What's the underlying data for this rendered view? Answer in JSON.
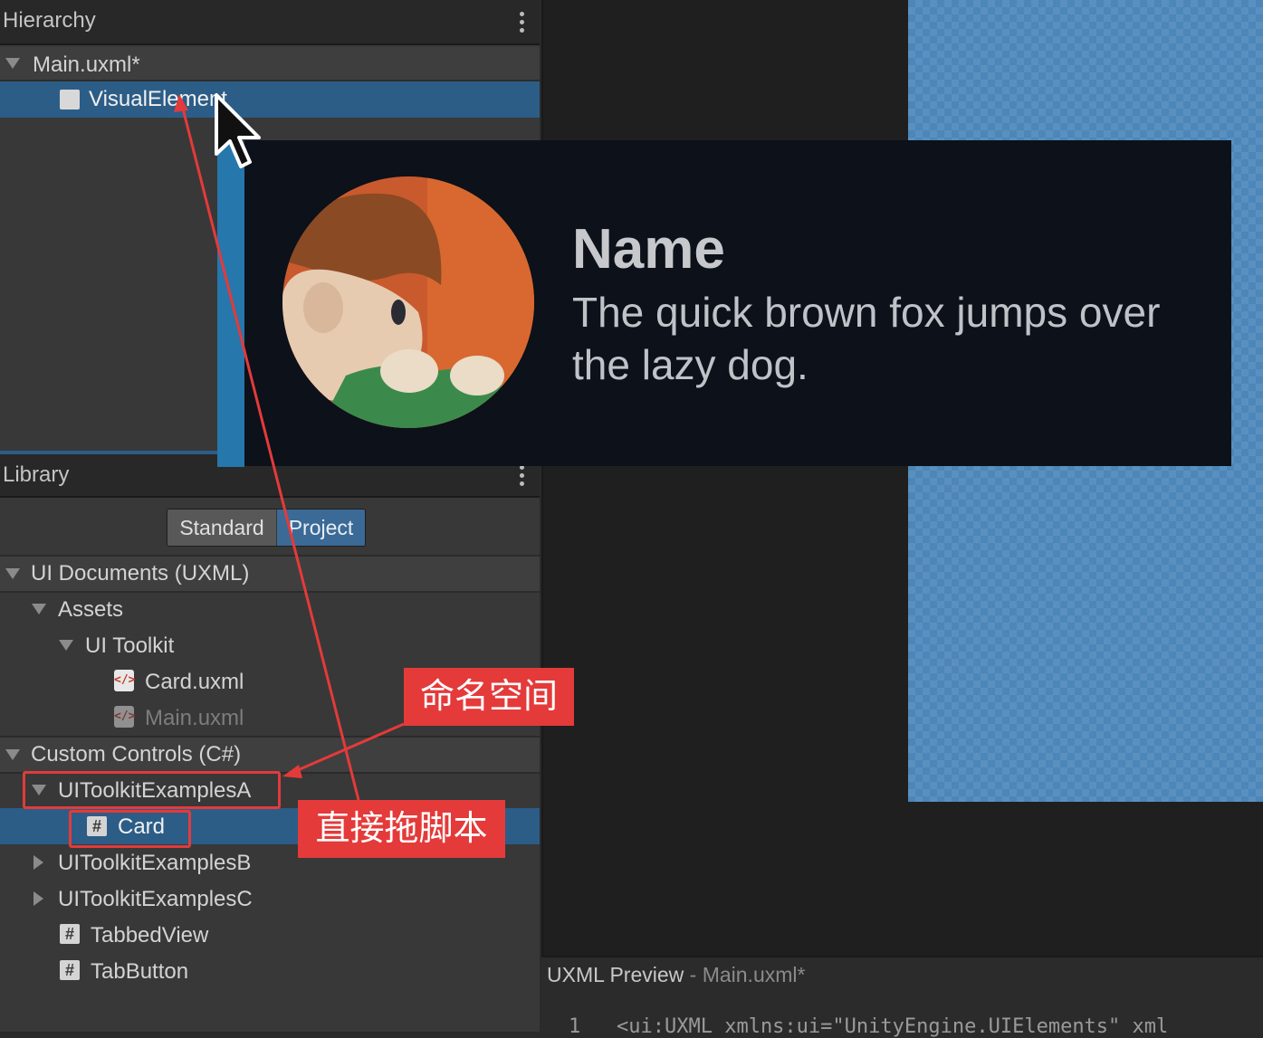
{
  "hierarchy": {
    "title": "Hierarchy",
    "document": "Main.uxml*",
    "selected_item": "VisualElement"
  },
  "library": {
    "title": "Library",
    "tabs": {
      "standard": "Standard",
      "project": "Project"
    },
    "sections": {
      "ui_documents": "UI Documents (UXML)",
      "custom_controls": "Custom Controls (C#)"
    },
    "tree": {
      "assets": "Assets",
      "ui_toolkit": "UI Toolkit",
      "card_uxml": "Card.uxml",
      "main_uxml": "Main.uxml",
      "ns_a": "UIToolkitExamplesA",
      "card": "Card",
      "ns_b": "UIToolkitExamplesB",
      "ns_c": "UIToolkitExamplesC",
      "tabbed_view": "TabbedView",
      "tab_button": "TabButton"
    }
  },
  "card": {
    "name": "Name",
    "description": "The quick brown fox jumps over the lazy dog."
  },
  "uxml_preview": {
    "title": "UXML Preview",
    "separator": "-",
    "file": "Main.uxml*",
    "line_number": "1",
    "code": "<ui:UXML xmlns:ui=\"UnityEngine.UIElements\" xml"
  },
  "annotations": {
    "namespace_label": "命名空间",
    "drag_label": "直接拖脚本"
  },
  "colors": {
    "selection": "#2c5d87",
    "annotation_red": "#e43a3a",
    "canvas_blue": "#4d86b8",
    "card_bg": "#0c111a"
  }
}
